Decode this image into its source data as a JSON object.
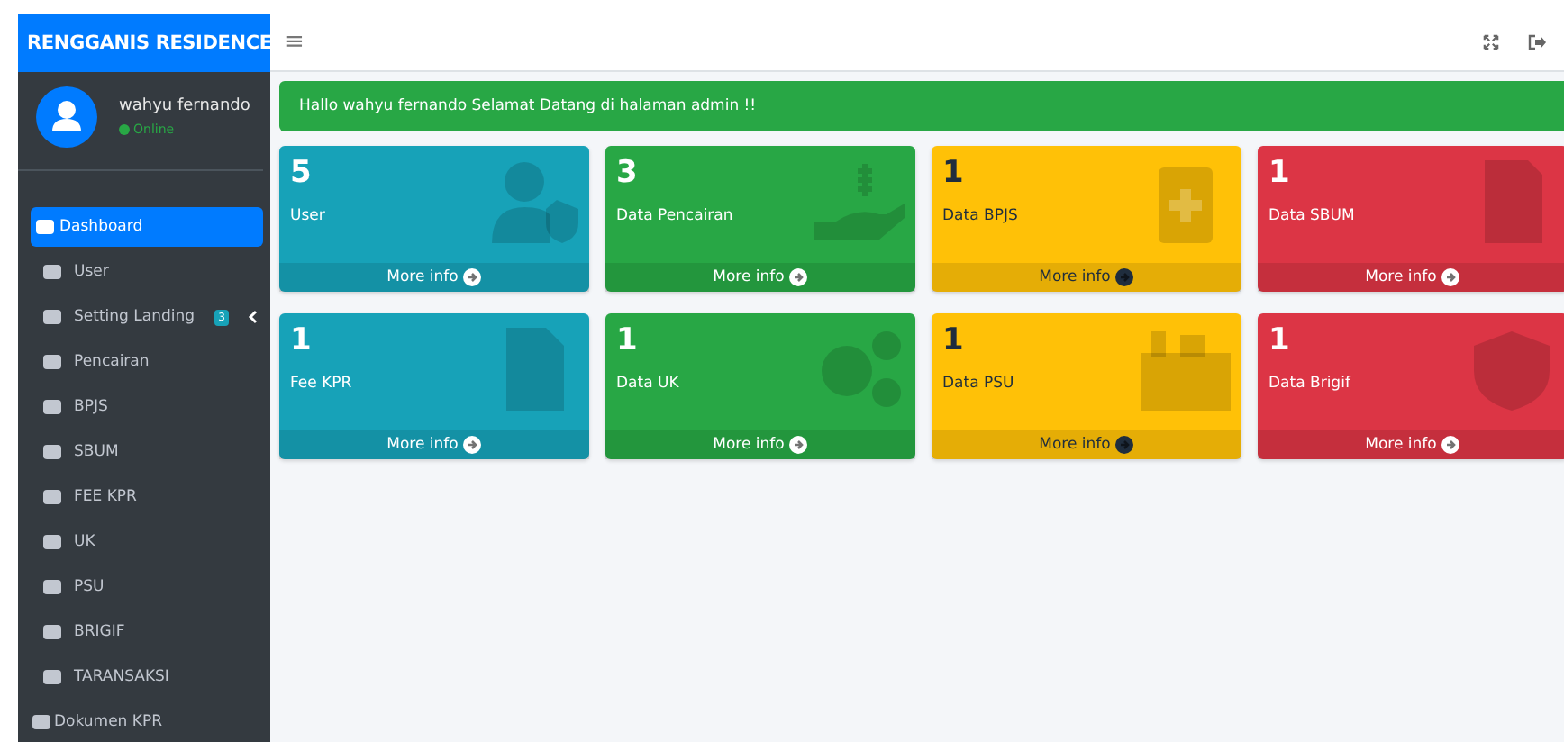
{
  "brand": {
    "title": "RENGGANIS RESIDENCE"
  },
  "user": {
    "name": "wahyu fernando",
    "status": "Online"
  },
  "sidebar": {
    "items": [
      {
        "label": "Dashboard",
        "selected": true,
        "kind": "nav"
      },
      {
        "label": "User",
        "selected": false,
        "kind": "nav"
      },
      {
        "label": "Setting Landing",
        "selected": false,
        "kind": "nav",
        "badge": "3"
      },
      {
        "label": "Pencairan",
        "selected": false,
        "kind": "nav"
      },
      {
        "label": "BPJS",
        "selected": false,
        "kind": "nav"
      },
      {
        "label": "SBUM",
        "selected": false,
        "kind": "nav"
      },
      {
        "label": "FEE KPR",
        "selected": false,
        "kind": "nav"
      },
      {
        "label": "UK",
        "selected": false,
        "kind": "nav"
      },
      {
        "label": "PSU",
        "selected": false,
        "kind": "nav"
      },
      {
        "label": "BRIGIF",
        "selected": false,
        "kind": "nav"
      },
      {
        "label": "TARANSAKSI",
        "selected": false,
        "kind": "nav"
      },
      {
        "label": "Dokumen KPR",
        "selected": false,
        "kind": "doc"
      }
    ]
  },
  "topbar": {
    "menu_icon": "≡"
  },
  "alert": {
    "text": "Hallo wahyu fernando Selamat Datang di halaman admin !!"
  },
  "cards": [
    {
      "count": "5",
      "label": "User",
      "link": "More info",
      "color": "#17a2b8"
    },
    {
      "count": "3",
      "label": "Data Pencairan",
      "link": "More info",
      "color": "#28a745"
    },
    {
      "count": "1",
      "label": "Data BPJS",
      "link": "More info",
      "color": "#ffc107"
    },
    {
      "count": "1",
      "label": "Data SBUM",
      "link": "More info",
      "color": "#dc3545"
    },
    {
      "count": "1",
      "label": "Fee KPR",
      "link": "More info",
      "color": "#17a2b8"
    },
    {
      "count": "1",
      "label": "Data UK",
      "link": "More info",
      "color": "#28a745"
    },
    {
      "count": "1",
      "label": "Data PSU",
      "link": "More info",
      "color": "#ffc107"
    },
    {
      "count": "1",
      "label": "Data Brigif",
      "link": "More info",
      "color": "#dc3545"
    }
  ]
}
